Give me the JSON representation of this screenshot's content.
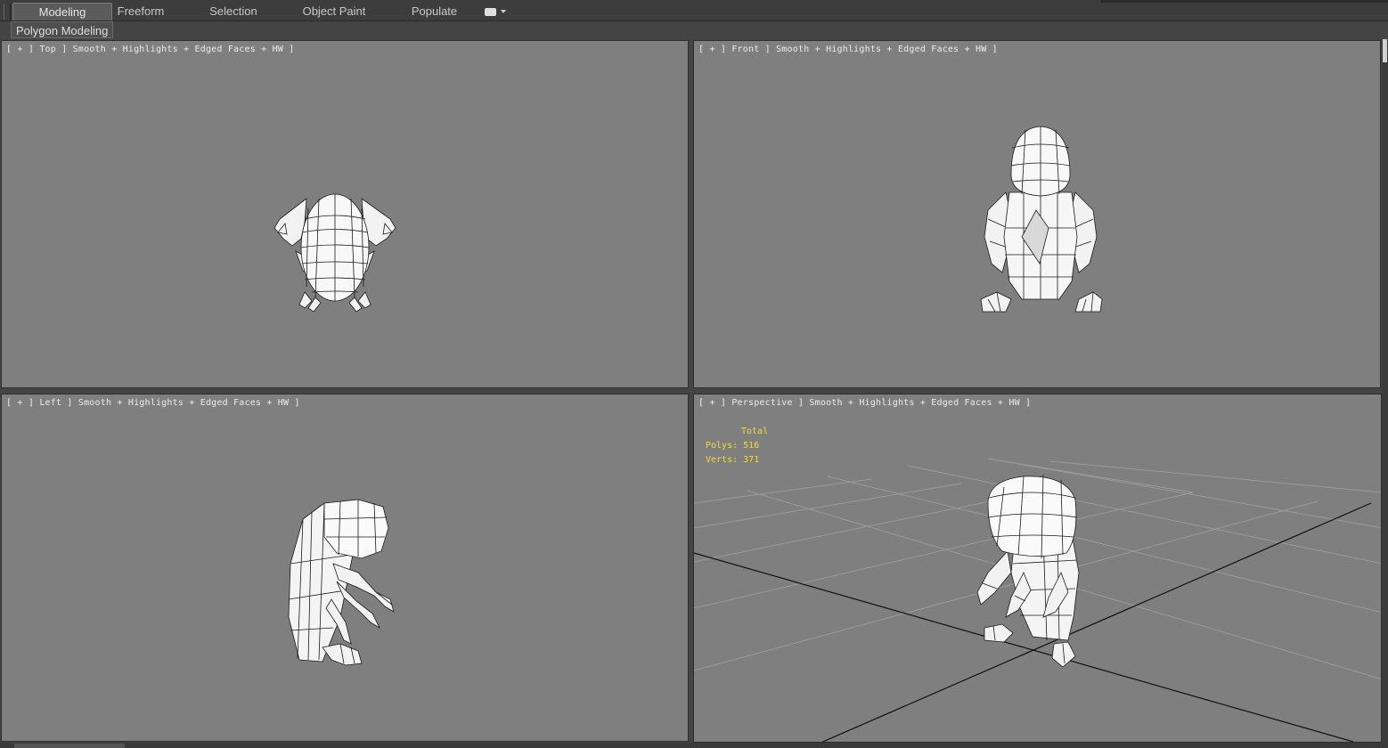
{
  "ribbon": {
    "tabs": [
      {
        "label": "Modeling",
        "active": true
      },
      {
        "label": "Freeform",
        "active": false
      },
      {
        "label": "Selection",
        "active": false
      },
      {
        "label": "Object Paint",
        "active": false
      },
      {
        "label": "Populate",
        "active": false
      }
    ],
    "sub_panel_label": "Polygon Modeling"
  },
  "viewports": {
    "top": {
      "label": "[ + ] Top ] Smooth + Highlights + Edged Faces + HW ]"
    },
    "front": {
      "label": "[ + ] Front ] Smooth + Highlights + Edged Faces + HW ]"
    },
    "left": {
      "label": "[ + ] Left ] Smooth + Highlights + Edged Faces + HW ]"
    },
    "perspective": {
      "label": "[ + ] Perspective ] Smooth + Highlights + Edged Faces + HW ]",
      "stats": {
        "title": "Total",
        "polys_label": "Polys:",
        "polys_value": "516",
        "verts_label": "Verts:",
        "verts_value": "371"
      }
    }
  },
  "colors": {
    "viewport_bg": "#7f7f7f",
    "stats_text": "#f2d64a",
    "ui_dark": "#444444"
  }
}
